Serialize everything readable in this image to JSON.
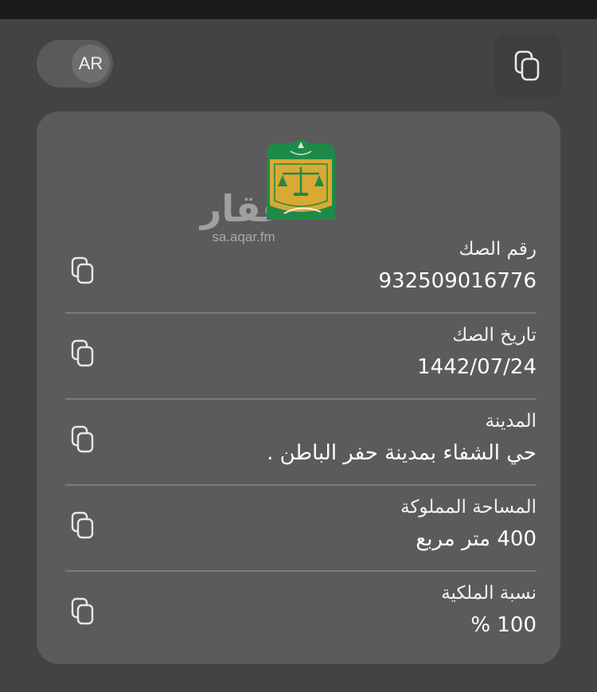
{
  "toggle": {
    "label": "AR"
  },
  "watermark": {
    "word": "عقار",
    "url": "sa.aqar.fm"
  },
  "fields": [
    {
      "label": "رقم الصك",
      "value": "932509016776"
    },
    {
      "label": "تاريخ الصك",
      "value": "1442/07/24"
    },
    {
      "label": "المدينة",
      "value": "حي  الشفاء  بمدينة حفر الباطن ."
    },
    {
      "label": "المساحة المملوكة",
      "value": "400 متر مربع"
    },
    {
      "label": "نسبة الملكية",
      "value": "100 %"
    }
  ],
  "icons": {
    "copy": "copy-icon",
    "logo": "ministry-of-justice-logo"
  },
  "colors": {
    "background": "#434343",
    "card": "#5b5b5b",
    "logo_green": "#1f8a48",
    "logo_gold": "#d9a934"
  }
}
